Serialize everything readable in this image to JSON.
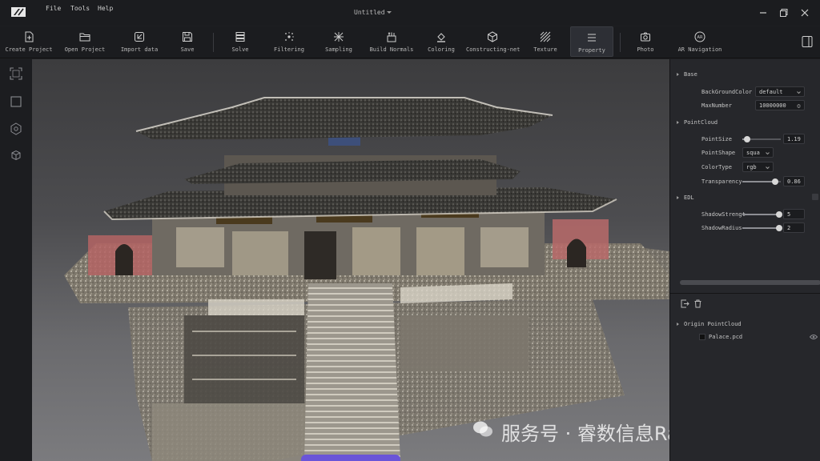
{
  "titlebar": {
    "menu": [
      "File",
      "Tools",
      "Help"
    ],
    "document_title": "Untitled"
  },
  "toolbar": {
    "tools": [
      {
        "label": "Create Project",
        "icon": "file-plus-icon"
      },
      {
        "label": "Open Project",
        "icon": "folder-open-icon"
      },
      {
        "label": "Import data",
        "icon": "import-icon"
      },
      {
        "label": "Save",
        "icon": "save-icon"
      },
      {
        "label": "Solve",
        "icon": "layers-stack-icon"
      },
      {
        "label": "Filtering",
        "icon": "filter-sparkle-icon"
      },
      {
        "label": "Sampling",
        "icon": "sampling-icon"
      },
      {
        "label": "Build Normals",
        "icon": "normals-icon"
      },
      {
        "label": "Coloring",
        "icon": "paint-bucket-icon"
      },
      {
        "label": "Constructing-net",
        "icon": "mesh-cube-icon"
      },
      {
        "label": "Texture",
        "icon": "texture-hatch-icon"
      },
      {
        "label": "Property",
        "icon": "property-list-icon",
        "active": true
      },
      {
        "label": "Photo",
        "icon": "camera-icon"
      },
      {
        "label": "AR Navigation",
        "icon": "ar-icon"
      }
    ]
  },
  "properties": {
    "base": {
      "title": "Base",
      "background_color_label": "BackGroundColor",
      "background_color_value": "default",
      "max_number_label": "MaxNumber",
      "max_number_value": "10000000"
    },
    "pointcloud": {
      "title": "PointCloud",
      "point_size_label": "PointSize",
      "point_size_value": "1.19",
      "point_size_fraction": 0.12,
      "point_shape_label": "PointShape",
      "point_shape_value": "squa",
      "color_type_label": "ColorType",
      "color_type_value": "rgb",
      "transparency_label": "Transparency",
      "transparency_value": "0.86",
      "transparency_fraction": 0.86
    },
    "edl": {
      "title": "EDL",
      "shadow_strength_label": "ShadowStrengt",
      "shadow_strength_value": "5",
      "shadow_strength_fraction": 0.95,
      "shadow_radius_label": "ShadowRadius",
      "shadow_radius_value": "2",
      "shadow_radius_fraction": 0.95
    }
  },
  "layers": {
    "group": "Origin PointCloud",
    "file": "Palace.pcd"
  },
  "viewport": {
    "watermark": "服务号 · 睿数信息RayZoom"
  },
  "colors": {
    "accent": "#6a55d8",
    "background": "#1e1f22",
    "panel": "#26272b"
  }
}
